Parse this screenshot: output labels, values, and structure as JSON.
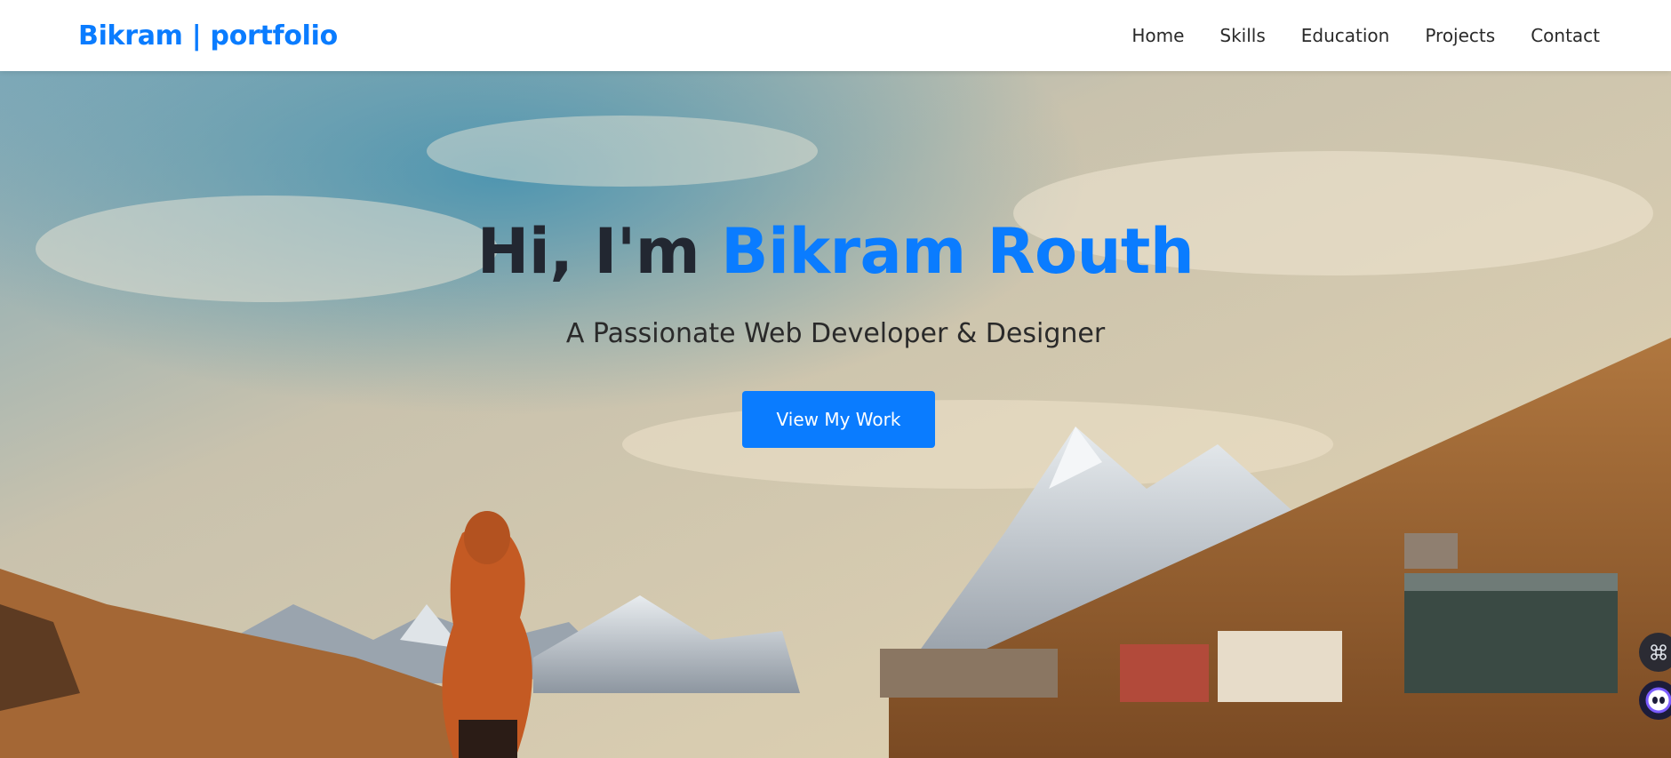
{
  "navbar": {
    "brand": "Bikram | portfolio",
    "links": [
      "Home",
      "Skills",
      "Education",
      "Projects",
      "Contact"
    ]
  },
  "hero": {
    "greeting": "Hi, I'm ",
    "name": "Bikram Routh",
    "subtitle": "A Passionate Web Developer & Designer",
    "cta_label": "View My Work"
  },
  "floating_widgets": [
    "command-icon",
    "chatbot-icon"
  ],
  "colors": {
    "accent": "#0a7cff",
    "heading": "#222731",
    "text": "#2a2a2a"
  }
}
